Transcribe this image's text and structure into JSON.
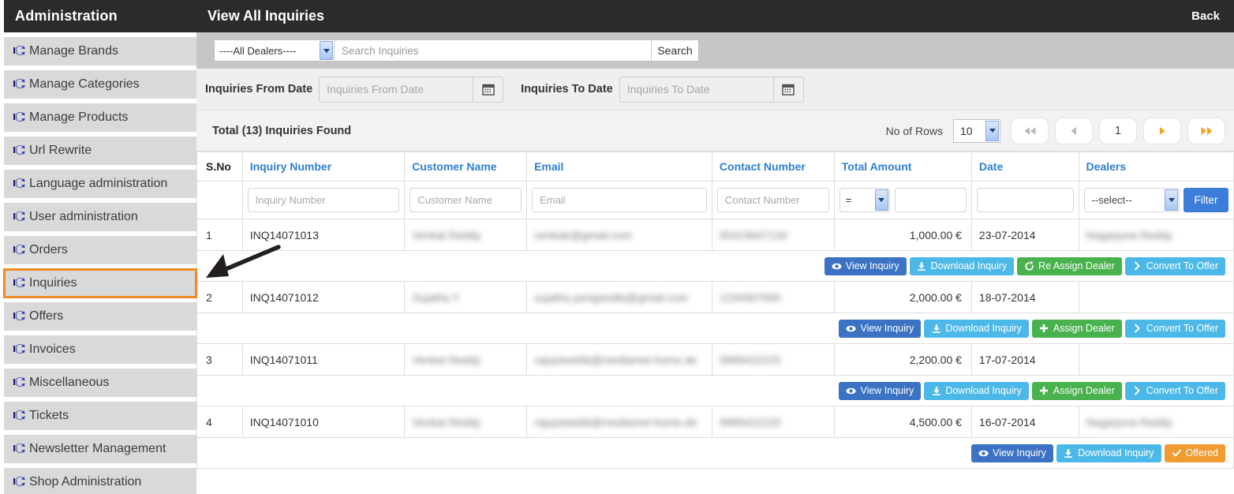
{
  "sidebar": {
    "title": "Administration",
    "items": [
      {
        "label": "Manage Brands",
        "highlighted": false
      },
      {
        "label": "Manage Categories",
        "highlighted": false
      },
      {
        "label": "Manage Products",
        "highlighted": false
      },
      {
        "label": "Url Rewrite",
        "highlighted": false
      },
      {
        "label": "Language administration",
        "highlighted": false
      },
      {
        "label": "User administration",
        "highlighted": false
      },
      {
        "label": "Orders",
        "highlighted": false
      },
      {
        "label": "Inquiries",
        "highlighted": true
      },
      {
        "label": "Offers",
        "highlighted": false
      },
      {
        "label": "Invoices",
        "highlighted": false
      },
      {
        "label": "Miscellaneous",
        "highlighted": false
      },
      {
        "label": "Tickets",
        "highlighted": false
      },
      {
        "label": "Newsletter Management",
        "highlighted": false
      },
      {
        "label": "Shop Administration",
        "highlighted": false
      }
    ]
  },
  "header": {
    "title": "View All Inquiries",
    "back_label": "Back"
  },
  "search": {
    "dealer_selected": "----All Dealers----",
    "input_placeholder": "Search Inquiries",
    "input_value": "",
    "button_label": "Search"
  },
  "date_filter": {
    "from_label": "Inquiries From Date",
    "from_placeholder": "Inquiries From Date",
    "from_value": "",
    "to_label": "Inquiries To Date",
    "to_placeholder": "Inquiries To Date",
    "to_value": "",
    "calendar_icon": "calendar-icon"
  },
  "toolbar": {
    "total_text": "Total (13) Inquiries Found",
    "rows_label": "No of Rows",
    "rows_value": "10",
    "page_current": "1",
    "first_icon": "double-left-icon",
    "prev_icon": "left-icon",
    "next_icon": "right-icon",
    "last_icon": "double-right-icon"
  },
  "table": {
    "columns": [
      "S.No",
      "Inquiry Number",
      "Customer Name",
      "Email",
      "Contact Number",
      "Total Amount",
      "Date",
      "Dealers"
    ],
    "filters": {
      "inquiry_placeholder": "Inquiry Number",
      "inquiry_value": "",
      "customer_placeholder": "Customer Name",
      "customer_value": "",
      "email_placeholder": "Email",
      "email_value": "",
      "contact_placeholder": "Contact Number",
      "contact_value": "",
      "amount_operator": "=",
      "amount_value": "",
      "date_value": "",
      "dealer_selected": "--select--",
      "filter_button": "Filter"
    },
    "rows": [
      {
        "sno": "1",
        "inquiry_number": "INQ14071013",
        "customer_name": "Venkat Reddy",
        "customer_redacted": true,
        "email": "venkatr@gmail.com",
        "email_redacted": true,
        "contact_number": "95419647134",
        "contact_redacted": true,
        "total_amount": "1,000.00 €",
        "date": "23-07-2014",
        "dealer": "Nagarjuna Reddy",
        "dealer_redacted": true,
        "actions": [
          {
            "label": "View Inquiry",
            "style": "btn-view",
            "icon": "eye-icon"
          },
          {
            "label": "Download Inquiry",
            "style": "btn-download",
            "icon": "download-icon"
          },
          {
            "label": "Re Assign Dealer",
            "style": "btn-reassign",
            "icon": "refresh-icon"
          },
          {
            "label": "Convert To Offer",
            "style": "btn-convert",
            "icon": "chevron-right-icon"
          }
        ]
      },
      {
        "sno": "2",
        "inquiry_number": "INQ14071012",
        "customer_name": "Sujatha Y",
        "customer_redacted": true,
        "email": "sujatha.yenigandla@gmail.com",
        "email_redacted": true,
        "contact_number": "1234567890",
        "contact_redacted": true,
        "total_amount": "2,000.00 €",
        "date": "18-07-2014",
        "dealer": "",
        "dealer_redacted": false,
        "actions": [
          {
            "label": "View Inquiry",
            "style": "btn-view",
            "icon": "eye-icon"
          },
          {
            "label": "Download Inquiry",
            "style": "btn-download",
            "icon": "download-icon"
          },
          {
            "label": "Assign Dealer",
            "style": "btn-assign",
            "icon": "plus-icon"
          },
          {
            "label": "Convert To Offer",
            "style": "btn-convert",
            "icon": "chevron-right-icon"
          }
        ]
      },
      {
        "sno": "3",
        "inquiry_number": "INQ14071011",
        "customer_name": "Venkat Reddy",
        "customer_redacted": true,
        "email": "rajujotwebb@mediamet-home.de",
        "email_redacted": true,
        "contact_number": "9989422225",
        "contact_redacted": true,
        "total_amount": "2,200.00 €",
        "date": "17-07-2014",
        "dealer": "",
        "dealer_redacted": false,
        "actions": [
          {
            "label": "View Inquiry",
            "style": "btn-view",
            "icon": "eye-icon"
          },
          {
            "label": "Download Inquiry",
            "style": "btn-download",
            "icon": "download-icon"
          },
          {
            "label": "Assign Dealer",
            "style": "btn-assign",
            "icon": "plus-icon"
          },
          {
            "label": "Convert To Offer",
            "style": "btn-convert",
            "icon": "chevron-right-icon"
          }
        ]
      },
      {
        "sno": "4",
        "inquiry_number": "INQ14071010",
        "customer_name": "Venkat Reddy",
        "customer_redacted": true,
        "email": "rajujotwebb@mediamet-home.de",
        "email_redacted": true,
        "contact_number": "9989422225",
        "contact_redacted": true,
        "total_amount": "4,500.00 €",
        "date": "16-07-2014",
        "dealer": "Nagarjuna Reddy",
        "dealer_redacted": true,
        "actions": [
          {
            "label": "View Inquiry",
            "style": "btn-view",
            "icon": "eye-icon"
          },
          {
            "label": "Download Inquiry",
            "style": "btn-download",
            "icon": "download-icon"
          },
          {
            "label": "Offered",
            "style": "btn-offered",
            "icon": "check-icon"
          }
        ]
      }
    ]
  },
  "annotation": {
    "arrow": "pointer-arrow",
    "target": "Inquiries"
  },
  "colors": {
    "header_bg": "#2b2b2b",
    "accent_blue": "#2f7fd0",
    "highlight_orange": "#f08a24",
    "green": "#49b14d",
    "light_blue": "#4cb8e8"
  }
}
